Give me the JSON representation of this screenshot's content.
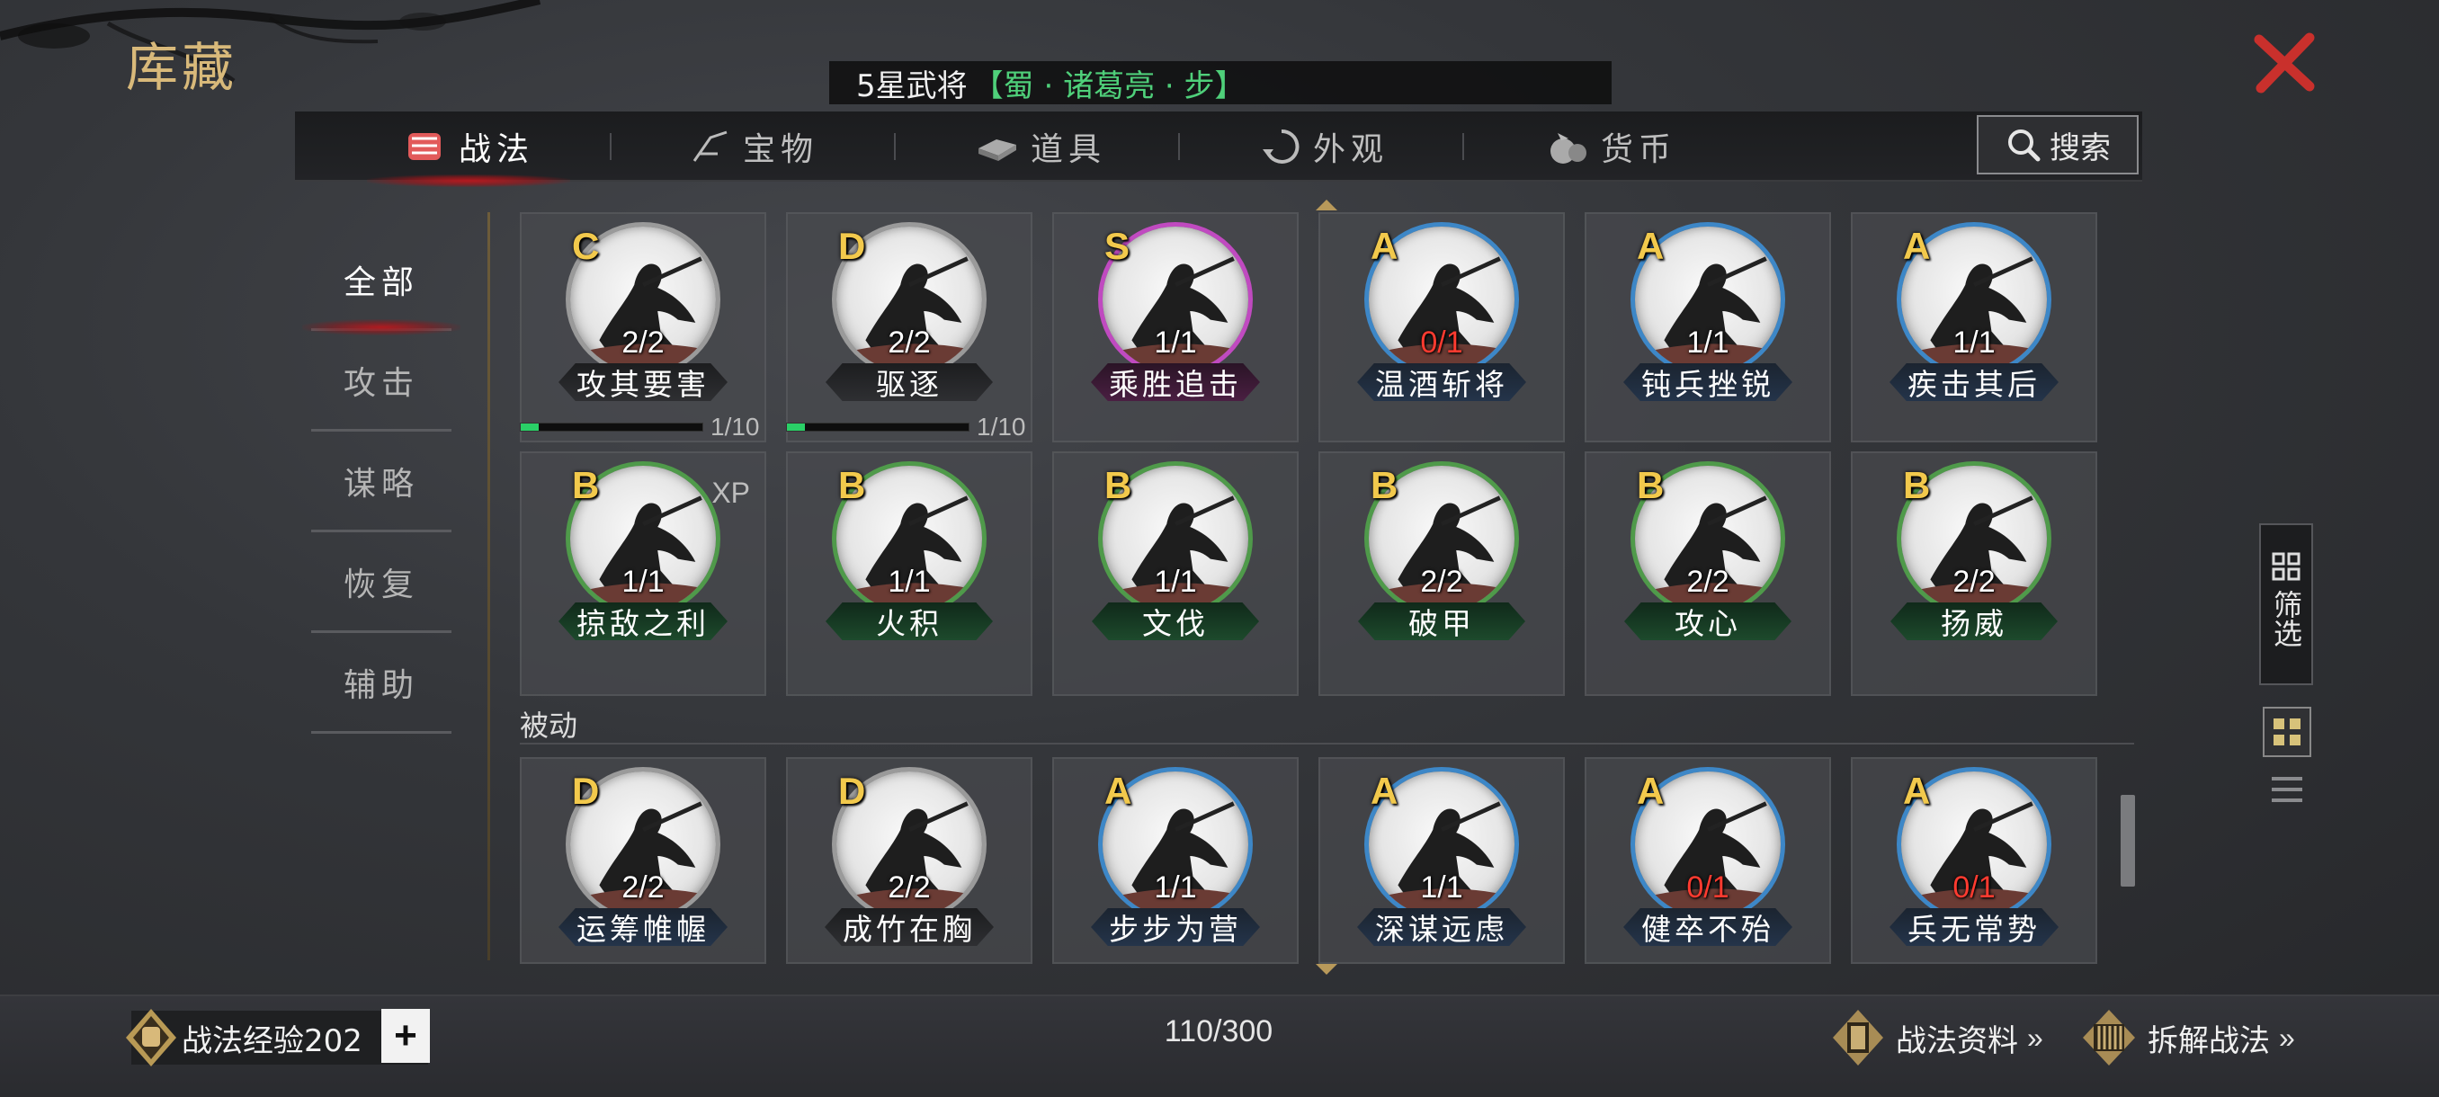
{
  "header": {
    "title": "库藏"
  },
  "hero_bar": {
    "stars_text": "5星武将",
    "hero_text": "【蜀 · 诸葛亮 · 步】"
  },
  "tabs": [
    {
      "label": "战法",
      "icon": "tactics-icon",
      "active": true
    },
    {
      "label": "宝物",
      "icon": "treasure-icon",
      "active": false
    },
    {
      "label": "道具",
      "icon": "item-icon",
      "active": false
    },
    {
      "label": "外观",
      "icon": "appearance-icon",
      "active": false
    },
    {
      "label": "货币",
      "icon": "currency-icon",
      "active": false
    }
  ],
  "search": {
    "label": "搜索"
  },
  "sidebar": {
    "items": [
      {
        "label": "全部",
        "active": true
      },
      {
        "label": "攻击",
        "active": false
      },
      {
        "label": "谋略",
        "active": false
      },
      {
        "label": "恢复",
        "active": false
      },
      {
        "label": "辅助",
        "active": false
      }
    ]
  },
  "active_cards": [
    {
      "grade": "C",
      "count": "2/2",
      "name": "攻其要害",
      "ring": "#9a9a9a",
      "plate": "gray",
      "progress": {
        "value": 0.1,
        "label": "1/10"
      }
    },
    {
      "grade": "D",
      "count": "2/2",
      "name": "驱逐",
      "ring": "#9a9a9a",
      "plate": "gray",
      "progress": {
        "value": 0.1,
        "label": "1/10"
      }
    },
    {
      "grade": "S",
      "count": "1/1",
      "name": "乘胜追击",
      "ring": "#c04ac0",
      "plate": "pink"
    },
    {
      "grade": "A",
      "count": "0/1",
      "name": "温酒斩将",
      "ring": "#3d87c7",
      "plate": "blue",
      "zero": true
    },
    {
      "grade": "A",
      "count": "1/1",
      "name": "钝兵挫锐",
      "ring": "#3d87c7",
      "plate": "blue"
    },
    {
      "grade": "A",
      "count": "1/1",
      "name": "疾击其后",
      "ring": "#3d87c7",
      "plate": "blue"
    },
    {
      "grade": "B",
      "count": "1/1",
      "name": "掠敌之利",
      "ring": "#4f9a4a",
      "plate": "green",
      "xp": "XP"
    },
    {
      "grade": "B",
      "count": "1/1",
      "name": "火积",
      "ring": "#4f9a4a",
      "plate": "green"
    },
    {
      "grade": "B",
      "count": "1/1",
      "name": "文伐",
      "ring": "#4f9a4a",
      "plate": "green"
    },
    {
      "grade": "B",
      "count": "2/2",
      "name": "破甲",
      "ring": "#4f9a4a",
      "plate": "green"
    },
    {
      "grade": "B",
      "count": "2/2",
      "name": "攻心",
      "ring": "#4f9a4a",
      "plate": "green"
    },
    {
      "grade": "B",
      "count": "2/2",
      "name": "扬威",
      "ring": "#4f9a4a",
      "plate": "green"
    }
  ],
  "section_passive": "被动",
  "passive_cards": [
    {
      "grade": "D",
      "count": "2/2",
      "name": "运筹帷幄",
      "ring": "#9a9a9a",
      "plate": "blue"
    },
    {
      "grade": "D",
      "count": "2/2",
      "name": "成竹在胸",
      "ring": "#9a9a9a",
      "plate": "gray"
    },
    {
      "grade": "A",
      "count": "1/1",
      "name": "步步为营",
      "ring": "#3d87c7",
      "plate": "blue"
    },
    {
      "grade": "A",
      "count": "1/1",
      "name": "深谋远虑",
      "ring": "#3d87c7",
      "plate": "blue"
    },
    {
      "grade": "A",
      "count": "0/1",
      "name": "健卒不殆",
      "ring": "#3d87c7",
      "plate": "blue",
      "zero": true
    },
    {
      "grade": "A",
      "count": "0/1",
      "name": "兵无常势",
      "ring": "#3d87c7",
      "plate": "blue",
      "zero": true
    }
  ],
  "filter": {
    "label": "筛选"
  },
  "bottom": {
    "exp_label": "战法经验202",
    "plus_label": "+",
    "count": "110/300",
    "info_label": "战法资料",
    "dismantle_label": "拆解战法",
    "chevron": "»"
  },
  "colors": {
    "accent_red": "#b4191f",
    "gold": "#d8b97a",
    "green_text": "#4fd07a",
    "zero_red": "#ff3b30"
  }
}
